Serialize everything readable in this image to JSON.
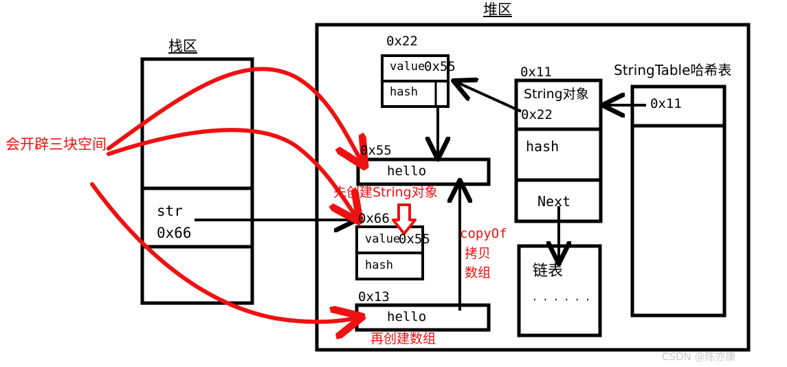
{
  "diagram": {
    "title_heap": "堆区",
    "title_stack": "栈区",
    "title_stringtable": "StringTable哈希表"
  },
  "stack": {
    "cells": [
      {
        "lines": []
      },
      {
        "lines": [
          "str",
          "0x66"
        ]
      },
      {
        "lines": []
      }
    ]
  },
  "heap": {
    "box_0x22": {
      "address": "0x22",
      "rows": [
        {
          "left": "value",
          "right": "0x55"
        },
        {
          "left": "hash",
          "right": ""
        }
      ]
    },
    "box_0x55": {
      "address": "0x55",
      "text": "hello"
    },
    "box_0x66": {
      "address": "0x66",
      "rows": [
        {
          "left": "value",
          "right": "0x55"
        },
        {
          "left": "hash",
          "right": ""
        }
      ]
    },
    "box_0x13": {
      "address": "0x13",
      "text": "hello"
    },
    "box_0x11": {
      "address": "0x11",
      "rows": [
        {
          "line1": "String对象",
          "line2": "0x22"
        },
        {
          "line1": "hash",
          "line2": ""
        },
        {
          "line1": "Next",
          "line2": ""
        }
      ]
    },
    "box_linkedlist": {
      "label": "链表",
      "dots": "· · · · · ·"
    },
    "stringtable": {
      "cells": [
        {
          "text": "0x11"
        },
        {
          "text": ""
        }
      ]
    }
  },
  "annotations": {
    "left_note": "会开辟三块空间",
    "note_create_string": "先创建String对象",
    "note_create_array": "再创建数组",
    "note_copyof_line1": "copyOf",
    "note_copyof_line2": "拷贝",
    "note_copyof_line3": "数组"
  },
  "watermark": "CSDN @陈亦康",
  "colors": {
    "ink": "#000000",
    "annotation_red": "#ee1111",
    "watermark_gray": "#c9c9c9",
    "background": "#ffffff"
  }
}
